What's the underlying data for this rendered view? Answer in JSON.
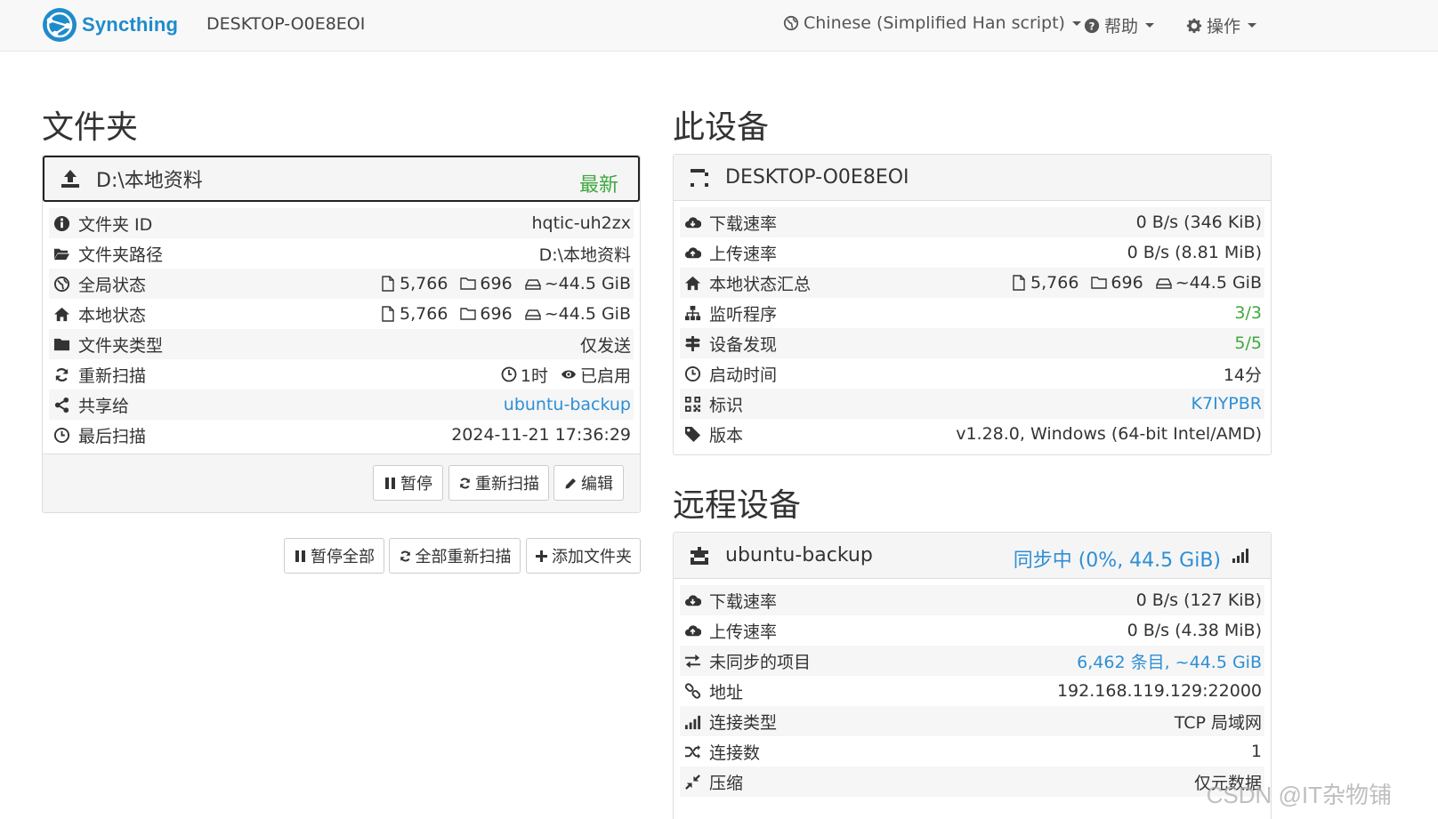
{
  "navbar": {
    "brand": "Syncthing",
    "hostname": "DESKTOP-O0E8EOI",
    "language": "Chinese (Simplified Han script)",
    "help": "帮助",
    "actions": "操作"
  },
  "folders": {
    "heading": "文件夹",
    "folder": {
      "name": "D:\\本地资料",
      "status": "最新",
      "rows": [
        {
          "label": "文件夹 ID",
          "value": "hqtic-uh2zx"
        },
        {
          "label": "文件夹路径",
          "value": "D:\\本地资料"
        },
        {
          "label": "全局状态",
          "files": "5,766",
          "dirs": "696",
          "size": "~44.5 GiB"
        },
        {
          "label": "本地状态",
          "files": "5,766",
          "dirs": "696",
          "size": "~44.5 GiB"
        },
        {
          "label": "文件夹类型",
          "value": "仅发送"
        },
        {
          "label": "重新扫描",
          "interval": "1时",
          "watch": "已启用"
        },
        {
          "label": "共享给",
          "value": "ubuntu-backup"
        },
        {
          "label": "最后扫描",
          "value": "2024-11-21 17:36:29"
        }
      ],
      "buttons": {
        "pause": "暂停",
        "rescan": "重新扫描",
        "edit": "编辑"
      }
    },
    "buttons": {
      "pause_all": "暂停全部",
      "rescan_all": "全部重新扫描",
      "add_folder": "添加文件夹"
    }
  },
  "this_device": {
    "heading": "此设备",
    "name": "DESKTOP-O0E8EOI",
    "rows": [
      {
        "label": "下载速率",
        "value": "0 B/s (346 KiB)"
      },
      {
        "label": "上传速率",
        "value": "0 B/s (8.81 MiB)"
      },
      {
        "label": "本地状态汇总",
        "files": "5,766",
        "dirs": "696",
        "size": "~44.5 GiB"
      },
      {
        "label": "监听程序",
        "value": "3/3"
      },
      {
        "label": "设备发现",
        "value": "5/5"
      },
      {
        "label": "启动时间",
        "value": "14分"
      },
      {
        "label": "标识",
        "value": "K7IYPBR"
      },
      {
        "label": "版本",
        "value": "v1.28.0, Windows (64-bit Intel/AMD)"
      }
    ]
  },
  "remote_devices": {
    "heading": "远程设备",
    "device": {
      "name": "ubuntu-backup",
      "status": "同步中 (0%, 44.5 GiB)",
      "rows": [
        {
          "label": "下载速率",
          "value": "0 B/s (127 KiB)"
        },
        {
          "label": "上传速率",
          "value": "0 B/s (4.38 MiB)"
        },
        {
          "label": "未同步的项目",
          "value": "6,462 条目, ~44.5 GiB"
        },
        {
          "label": "地址",
          "value": "192.168.119.129:22000"
        },
        {
          "label": "连接类型",
          "value": "TCP 局域网"
        },
        {
          "label": "连接数",
          "value": "1"
        },
        {
          "label": "压缩",
          "value": "仅元数据"
        }
      ]
    }
  },
  "watermark": "CSDN @IT杂物铺",
  "colors": {
    "brand": "#1f8bcb",
    "success": "#3fa83f",
    "link": "#2d8fd5"
  }
}
